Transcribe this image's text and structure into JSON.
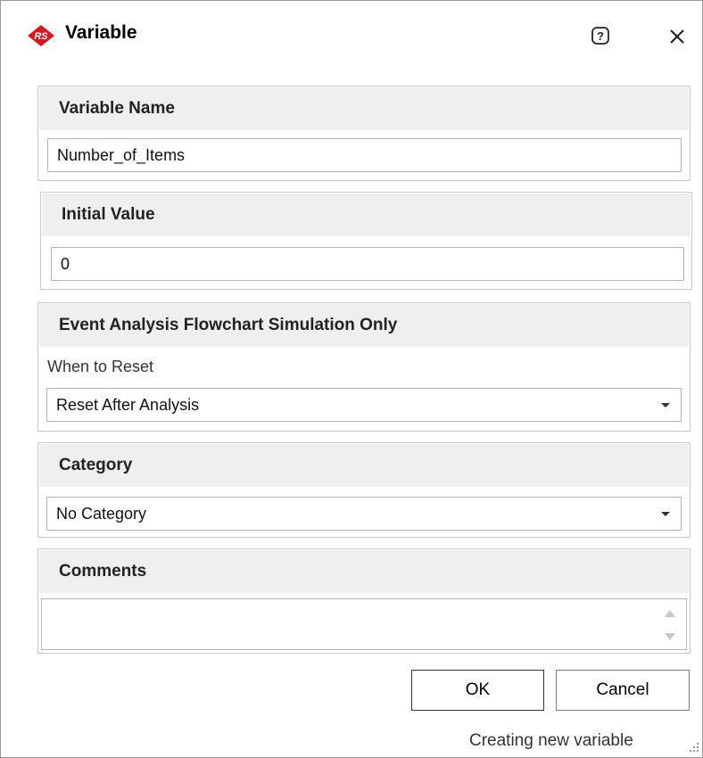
{
  "window": {
    "title": "Variable",
    "app_icon": "rs-logo-icon",
    "help_icon": "help-icon",
    "close_icon": "close-icon",
    "accent_color": "#d41a1f"
  },
  "variable_name": {
    "header": "Variable Name",
    "value": "Number_of_Items"
  },
  "initial_value": {
    "header": "Initial Value",
    "value": "0"
  },
  "event_analysis": {
    "header": "Event Analysis Flowchart Simulation Only",
    "reset_label": "When to Reset",
    "reset_value": "Reset After Analysis"
  },
  "category": {
    "header": "Category",
    "value": "No Category"
  },
  "comments": {
    "header": "Comments",
    "value": ""
  },
  "buttons": {
    "ok": "OK",
    "cancel": "Cancel"
  },
  "status": {
    "text": "Creating new variable"
  }
}
